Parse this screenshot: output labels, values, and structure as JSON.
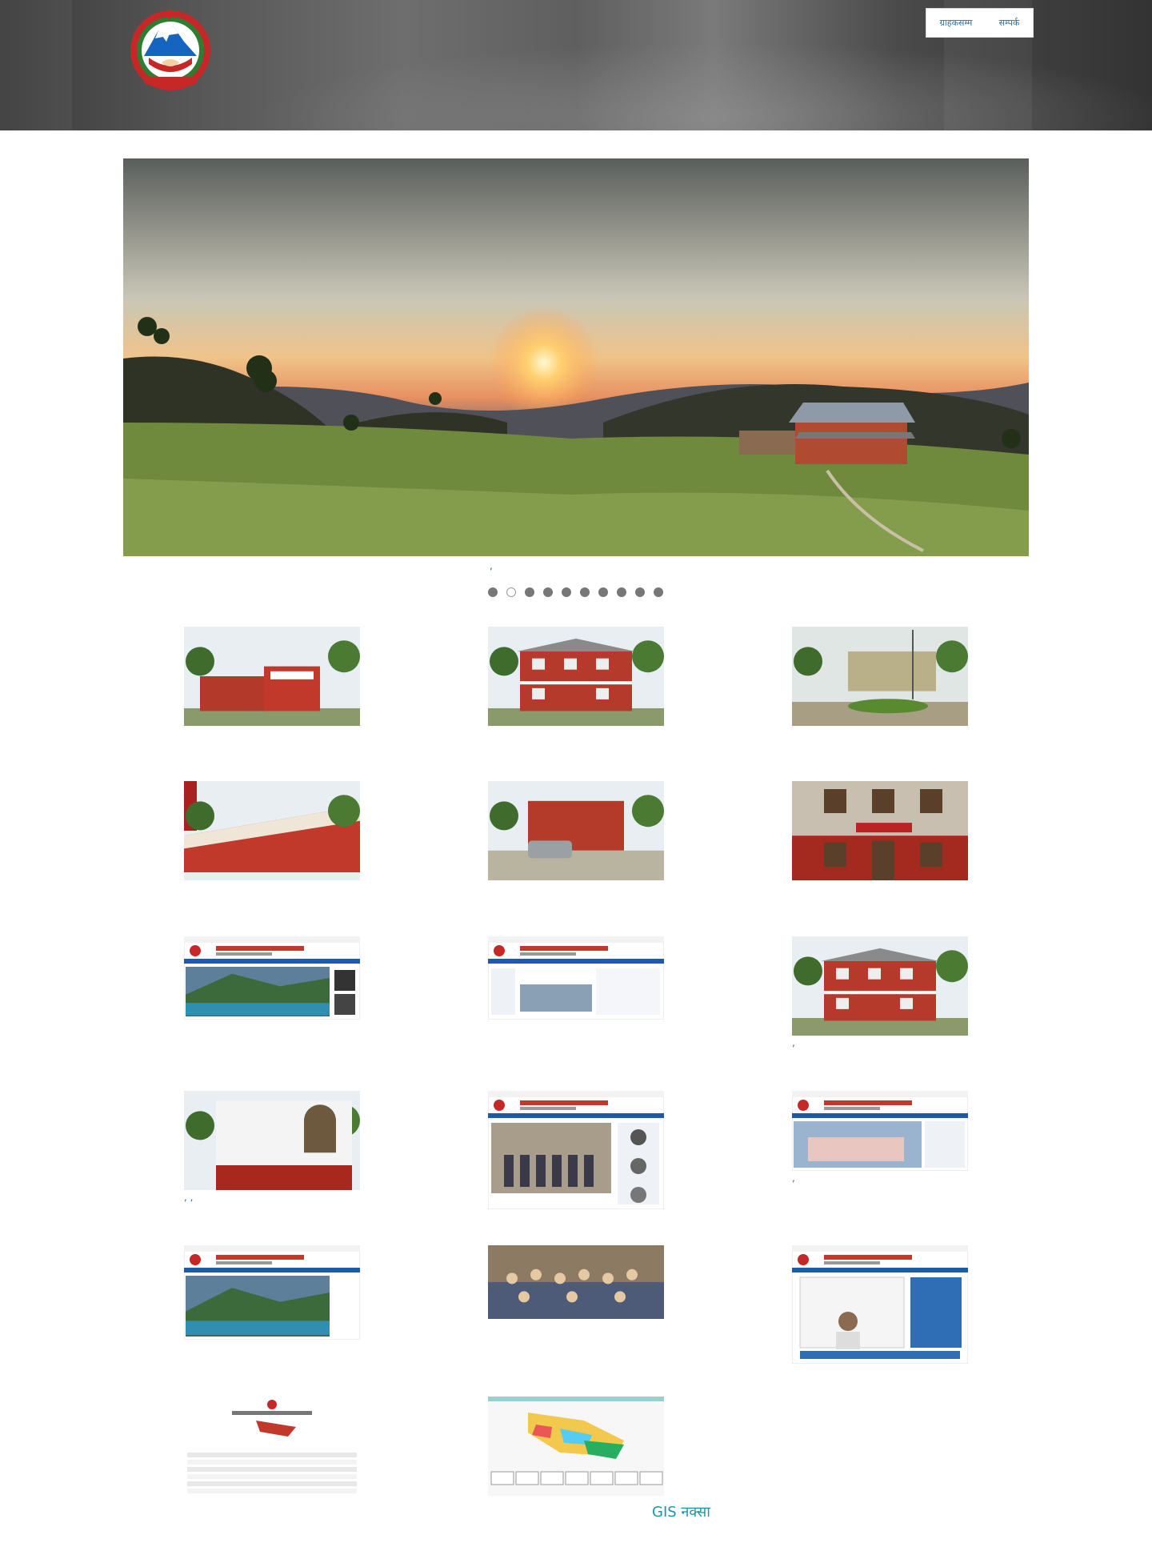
{
  "header": {
    "emblem_label": "emblem",
    "nav": [
      "ग्राहकसम्म",
      "सम्पर्क"
    ]
  },
  "hero": {
    "caption_mark": ",",
    "slide_count": 10,
    "active_slide": 1
  },
  "cards": [
    {
      "title": ""
    },
    {
      "title": ""
    },
    {
      "title": ""
    },
    {
      "title": ""
    },
    {
      "title": ""
    },
    {
      "title": ""
    },
    {
      "title": ""
    },
    {
      "title": ""
    },
    {
      "title": ","
    },
    {
      "title": ",           ,"
    },
    {
      "title": ""
    },
    {
      "title": ","
    },
    {
      "title": ""
    },
    {
      "title": ""
    },
    {
      "title": ""
    },
    {
      "title": ""
    },
    {
      "title": ""
    }
  ],
  "footer": {
    "gis_label": "GIS नक्सा"
  },
  "colors": {
    "link": "#1b6fa8",
    "gis": "#1e93a8"
  }
}
